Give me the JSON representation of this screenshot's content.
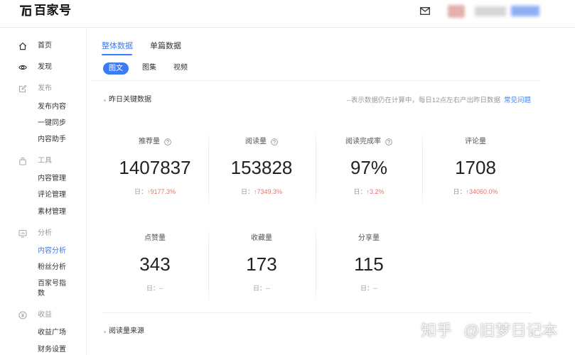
{
  "colors": {
    "accent": "#3b7cf6",
    "up": "#e8736f",
    "text": "#222222",
    "muted": "#999999"
  },
  "header": {
    "logo_icon": "baijiahao-logo-icon",
    "logo_text": "百家号",
    "mail_icon": "mail-icon"
  },
  "sidebar": {
    "home": {
      "icon": "home-icon",
      "label": "首页"
    },
    "discover": {
      "icon": "eye-icon",
      "label": "发现"
    },
    "sections": [
      {
        "icon": "edit-icon",
        "label": "发布",
        "items": [
          {
            "label": "发布内容",
            "active": false
          },
          {
            "label": "一键同步",
            "active": false
          },
          {
            "label": "内容助手",
            "active": false
          }
        ]
      },
      {
        "icon": "shopping-bag-icon",
        "label": "工具",
        "items": [
          {
            "label": "内容管理",
            "active": false
          },
          {
            "label": "评论管理",
            "active": false
          },
          {
            "label": "素材管理",
            "active": false
          }
        ]
      },
      {
        "icon": "monitor-chart-icon",
        "label": "分析",
        "items": [
          {
            "label": "内容分析",
            "active": true
          },
          {
            "label": "粉丝分析",
            "active": false
          },
          {
            "label": "百家号指数",
            "active": false
          }
        ]
      },
      {
        "icon": "coin-icon",
        "label": "收益",
        "items": [
          {
            "label": "收益广场",
            "active": false
          },
          {
            "label": "财务设置",
            "active": false
          }
        ]
      }
    ]
  },
  "main": {
    "tabs": [
      {
        "label": "整体数据",
        "active": true
      },
      {
        "label": "单篇数据",
        "active": false
      }
    ],
    "content_types": [
      {
        "label": "图文",
        "active": true
      },
      {
        "label": "图集",
        "active": false
      },
      {
        "label": "视频",
        "active": false
      }
    ]
  },
  "stats": {
    "section_title": "昨日关键数据",
    "note": "--表示数据仍在计算中，每日12点左右产出昨日数据",
    "help_link": "常见问题",
    "metrics": [
      {
        "label": "推荐量",
        "help_icon": "question-circle-icon",
        "value": "1407837",
        "change_prefix": "日：",
        "change": "↑9177.3%"
      },
      {
        "label": "阅读量",
        "help_icon": "question-circle-icon",
        "value": "153828",
        "change_prefix": "日：",
        "change": "↑7349.3%"
      },
      {
        "label": "阅读完成率",
        "help_icon": "question-circle-icon",
        "value": "97%",
        "change_prefix": "日：",
        "change": "↑3.2%"
      },
      {
        "label": "评论量",
        "value": "1708",
        "change_prefix": "日：",
        "change": "↑34060.0%"
      },
      {
        "label": "点赞量",
        "value": "343",
        "change_prefix": "日：",
        "change": "--"
      },
      {
        "label": "收藏量",
        "value": "173",
        "change_prefix": "日：",
        "change": "--"
      },
      {
        "label": "分享量",
        "value": "115",
        "change_prefix": "日：",
        "change": "--"
      }
    ]
  },
  "read_source": {
    "section_title": "阅读量来源"
  },
  "watermark": "知乎 @旧梦日记本"
}
